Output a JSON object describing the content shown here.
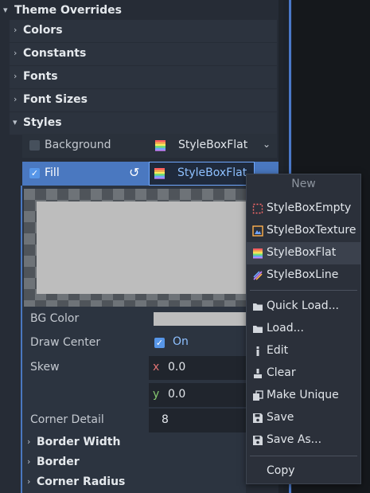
{
  "inspector": {
    "theme_overrides": "Theme Overrides",
    "sections": [
      "Colors",
      "Constants",
      "Fonts",
      "Font Sizes",
      "Styles"
    ],
    "background": {
      "label": "Background",
      "value": "StyleBoxFlat",
      "checked": false
    },
    "fill": {
      "label": "Fill",
      "value": "StyleBoxFlat",
      "checked": true
    },
    "bg_color_label": "BG Color",
    "bg_color": "#bdbdbd",
    "draw_center_label": "Draw Center",
    "draw_center_value": "On",
    "skew_label": "Skew",
    "skew_x_axis": "x",
    "skew_x": "0.0",
    "skew_y_axis": "y",
    "skew_y": "0.0",
    "corner_detail_label": "Corner Detail",
    "corner_detail": "8",
    "subsections": [
      "Border Width",
      "Border",
      "Corner Radius"
    ]
  },
  "menu": {
    "header": "New",
    "new_items": [
      {
        "label": "StyleBoxEmpty",
        "icon": "styleboxempty-icon"
      },
      {
        "label": "StyleBoxTexture",
        "icon": "styleboxtexture-icon"
      },
      {
        "label": "StyleBoxFlat",
        "icon": "styleboxflat-icon",
        "highlighted": true
      },
      {
        "label": "StyleBoxLine",
        "icon": "styleboxline-icon"
      }
    ],
    "actions": [
      {
        "label": "Quick Load...",
        "icon": "folder-icon"
      },
      {
        "label": "Load...",
        "icon": "folder-icon"
      },
      {
        "label": "Edit",
        "icon": "edit-icon"
      },
      {
        "label": "Clear",
        "icon": "clear-icon"
      },
      {
        "label": "Make Unique",
        "icon": "duplicate-icon"
      },
      {
        "label": "Save",
        "icon": "save-icon"
      },
      {
        "label": "Save As...",
        "icon": "save-icon"
      }
    ],
    "copy": "Copy"
  },
  "colors": {
    "accent": "#5796e8",
    "highlight": "#3b414d",
    "panel": "#262c36"
  }
}
